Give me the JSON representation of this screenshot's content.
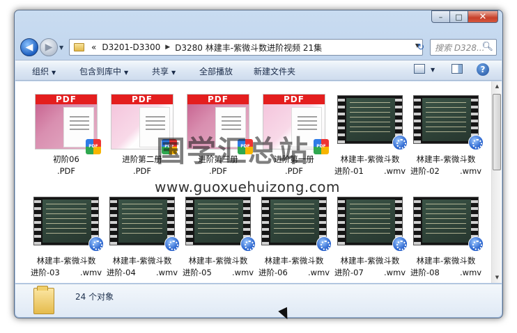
{
  "caption": {
    "minimize": "–",
    "maximize": "□",
    "close": "✕"
  },
  "nav": {
    "back": "◀",
    "forward": "▶",
    "history": "▼"
  },
  "address": {
    "overflow": "«",
    "crumbs": [
      "D3201-D3300",
      "D3280 林建丰-紫微斗数进阶视频    21集"
    ],
    "separator": "▶",
    "dropdown": "▼"
  },
  "refresh_glyph": "↻",
  "search": {
    "placeholder": "搜索 D328...",
    "icon": "search-icon"
  },
  "commands": {
    "organize": "组织",
    "include_in_library": "包含到库中",
    "share": "共享",
    "play_all": "全部播放",
    "new_folder": "新建文件夹",
    "help": "?"
  },
  "items": [
    {
      "line1": "初阶06",
      "line2": ".PDF",
      "kind": "pdf"
    },
    {
      "line1": "进阶第二册",
      "line2": ".PDF",
      "kind": "pdf-light"
    },
    {
      "line1": "进阶第三册",
      "line2": ".PDF",
      "kind": "pdf"
    },
    {
      "line1": "进阶第一册",
      "line2": ".PDF",
      "kind": "pdf-light"
    },
    {
      "line1": "林建丰-紫微斗数",
      "line2": "进阶-01        .wmv",
      "kind": "wmv"
    },
    {
      "line1": "林建丰-紫微斗数",
      "line2": "进阶-02        .wmv",
      "kind": "wmv"
    },
    {
      "line1": "林建丰-紫微斗数",
      "line2": "进阶-03        .wmv",
      "kind": "wmv"
    },
    {
      "line1": "林建丰-紫微斗数",
      "line2": "进阶-04        .wmv",
      "kind": "wmv"
    },
    {
      "line1": "林建丰-紫微斗数",
      "line2": "进阶-05        .wmv",
      "kind": "wmv"
    },
    {
      "line1": "林建丰-紫微斗数",
      "line2": "进阶-06        .wmv",
      "kind": "wmv"
    },
    {
      "line1": "林建丰-紫微斗数",
      "line2": "进阶-07        .wmv",
      "kind": "wmv"
    },
    {
      "line1": "林建丰-紫微斗数",
      "line2": "进阶-08        .wmv",
      "kind": "wmv"
    }
  ],
  "pdf_badge_text": "PDF",
  "pdf_band_text": "PDF",
  "watermark": {
    "cn": "国学汇总站",
    "url": "www.guoxuehuizong.com"
  },
  "status": {
    "count": "24 个对象"
  },
  "colors": {
    "pdf_band": "#e41e1e",
    "accent": "#1a57c8"
  }
}
